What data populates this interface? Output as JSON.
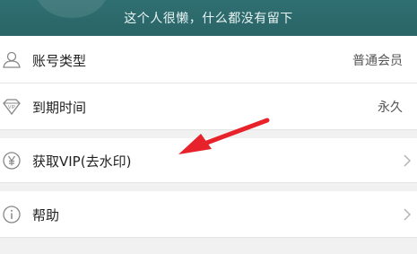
{
  "header": {
    "motto": "这个人很懒，什么都没有留下"
  },
  "rows": [
    {
      "icon": "user-icon",
      "label": "账号类型",
      "value": "普通会员"
    },
    {
      "icon": "vip-diamond-icon",
      "label": "到期时间",
      "value": "永久"
    },
    {
      "icon": "yen-icon",
      "label": "获取VIP(去水印)",
      "chevron": "chevron-right-icon"
    },
    {
      "icon": "info-icon",
      "label": "帮助",
      "chevron": "chevron-right-icon"
    }
  ],
  "colors": {
    "header": "#2c686a",
    "arrow": "#e8222a",
    "background": "#f1f1f1"
  }
}
